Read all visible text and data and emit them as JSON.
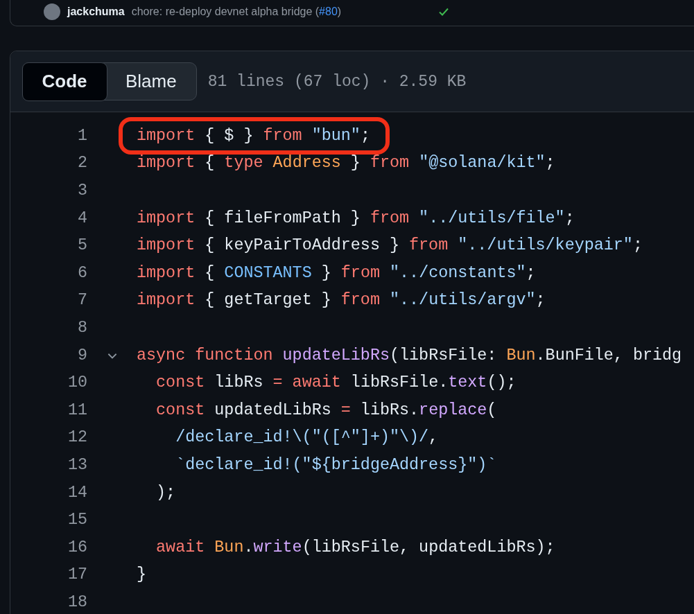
{
  "commit": {
    "author": "jackchuma",
    "message": "chore: re-deploy devnet alpha bridge (",
    "pr_link": "#80",
    "message_end": ")",
    "checks_passed": true
  },
  "file_view": {
    "tabs": [
      {
        "label": "Code",
        "selected": true
      },
      {
        "label": "Blame",
        "selected": false
      }
    ],
    "file_info": "81 lines (67 loc) · 2.59 KB",
    "lines": [
      {
        "number": "1",
        "annotated": true,
        "tokens": [
          {
            "text": "import",
            "kind": "keyword"
          },
          {
            "text": " { $ } ",
            "kind": "plain"
          },
          {
            "text": "from",
            "kind": "keyword"
          },
          {
            "text": " \"bun\"",
            "kind": "string"
          },
          {
            "text": ";",
            "kind": "plain"
          }
        ]
      },
      {
        "number": "2",
        "tokens": [
          {
            "text": "import",
            "kind": "keyword"
          },
          {
            "text": " { ",
            "kind": "plain"
          },
          {
            "text": "type",
            "kind": "keyword"
          },
          {
            "text": " Address",
            "kind": "type"
          },
          {
            "text": " } ",
            "kind": "plain"
          },
          {
            "text": "from",
            "kind": "keyword"
          },
          {
            "text": " \"@solana/kit\"",
            "kind": "string"
          },
          {
            "text": ";",
            "kind": "plain"
          }
        ]
      },
      {
        "number": "3"
      },
      {
        "number": "4",
        "tokens": [
          {
            "text": "import",
            "kind": "keyword"
          },
          {
            "text": " { fileFromPath } ",
            "kind": "plain"
          },
          {
            "text": "from",
            "kind": "keyword"
          },
          {
            "text": " \"../utils/file\"",
            "kind": "string"
          },
          {
            "text": ";",
            "kind": "plain"
          }
        ]
      },
      {
        "number": "5",
        "tokens": [
          {
            "text": "import",
            "kind": "keyword"
          },
          {
            "text": " { keyPairToAddress } ",
            "kind": "plain"
          },
          {
            "text": "from",
            "kind": "keyword"
          },
          {
            "text": " \"../utils/keypair\"",
            "kind": "string"
          },
          {
            "text": ";",
            "kind": "plain"
          }
        ]
      },
      {
        "number": "6",
        "tokens": [
          {
            "text": "import",
            "kind": "keyword"
          },
          {
            "text": " { ",
            "kind": "plain"
          },
          {
            "text": "CONSTANTS",
            "kind": "constant"
          },
          {
            "text": " } ",
            "kind": "plain"
          },
          {
            "text": "from",
            "kind": "keyword"
          },
          {
            "text": " \"../constants\"",
            "kind": "string"
          },
          {
            "text": ";",
            "kind": "plain"
          }
        ]
      },
      {
        "number": "7",
        "tokens": [
          {
            "text": "import",
            "kind": "keyword"
          },
          {
            "text": " { getTarget } ",
            "kind": "plain"
          },
          {
            "text": "from",
            "kind": "keyword"
          },
          {
            "text": " \"../utils/argv\"",
            "kind": "string"
          },
          {
            "text": ";",
            "kind": "plain"
          }
        ]
      },
      {
        "number": "8"
      },
      {
        "number": "9",
        "foldable": true,
        "expanded": true,
        "tokens": [
          {
            "text": "async",
            "kind": "keyword"
          },
          {
            "text": " function",
            "kind": "keyword"
          },
          {
            "text": " updateLibRs",
            "kind": "function"
          },
          {
            "text": "(libRsFile: ",
            "kind": "plain"
          },
          {
            "text": "Bun",
            "kind": "type"
          },
          {
            "text": ".BunFile, bridg",
            "kind": "plain"
          }
        ]
      },
      {
        "number": "10",
        "tokens": [
          {
            "text": "  const",
            "kind": "keyword"
          },
          {
            "text": " libRs ",
            "kind": "plain"
          },
          {
            "text": "=",
            "kind": "keyword"
          },
          {
            "text": " await",
            "kind": "keyword"
          },
          {
            "text": " libRsFile.",
            "kind": "plain"
          },
          {
            "text": "text",
            "kind": "function"
          },
          {
            "text": "();",
            "kind": "plain"
          }
        ]
      },
      {
        "number": "11",
        "tokens": [
          {
            "text": "  const",
            "kind": "keyword"
          },
          {
            "text": " updatedLibRs ",
            "kind": "plain"
          },
          {
            "text": "=",
            "kind": "keyword"
          },
          {
            "text": " libRs.",
            "kind": "plain"
          },
          {
            "text": "replace",
            "kind": "function"
          },
          {
            "text": "(",
            "kind": "plain"
          }
        ]
      },
      {
        "number": "12",
        "tokens": [
          {
            "text": "    /declare_id!\\(\"([^\"]+)\"\\)/",
            "kind": "string"
          },
          {
            "text": ",",
            "kind": "plain"
          }
        ]
      },
      {
        "number": "13",
        "tokens": [
          {
            "text": "    `declare_id!(\"${bridgeAddress}\")`",
            "kind": "string"
          }
        ]
      },
      {
        "number": "14",
        "tokens": [
          {
            "text": "  );",
            "kind": "plain"
          }
        ]
      },
      {
        "number": "15"
      },
      {
        "number": "16",
        "tokens": [
          {
            "text": "  await",
            "kind": "keyword"
          },
          {
            "text": " Bun",
            "kind": "type"
          },
          {
            "text": ".",
            "kind": "plain"
          },
          {
            "text": "write",
            "kind": "function"
          },
          {
            "text": "(libRsFile, updatedLibRs);",
            "kind": "plain"
          }
        ]
      },
      {
        "number": "17",
        "tokens": [
          {
            "text": "}",
            "kind": "plain"
          }
        ]
      },
      {
        "number": "18"
      }
    ]
  }
}
